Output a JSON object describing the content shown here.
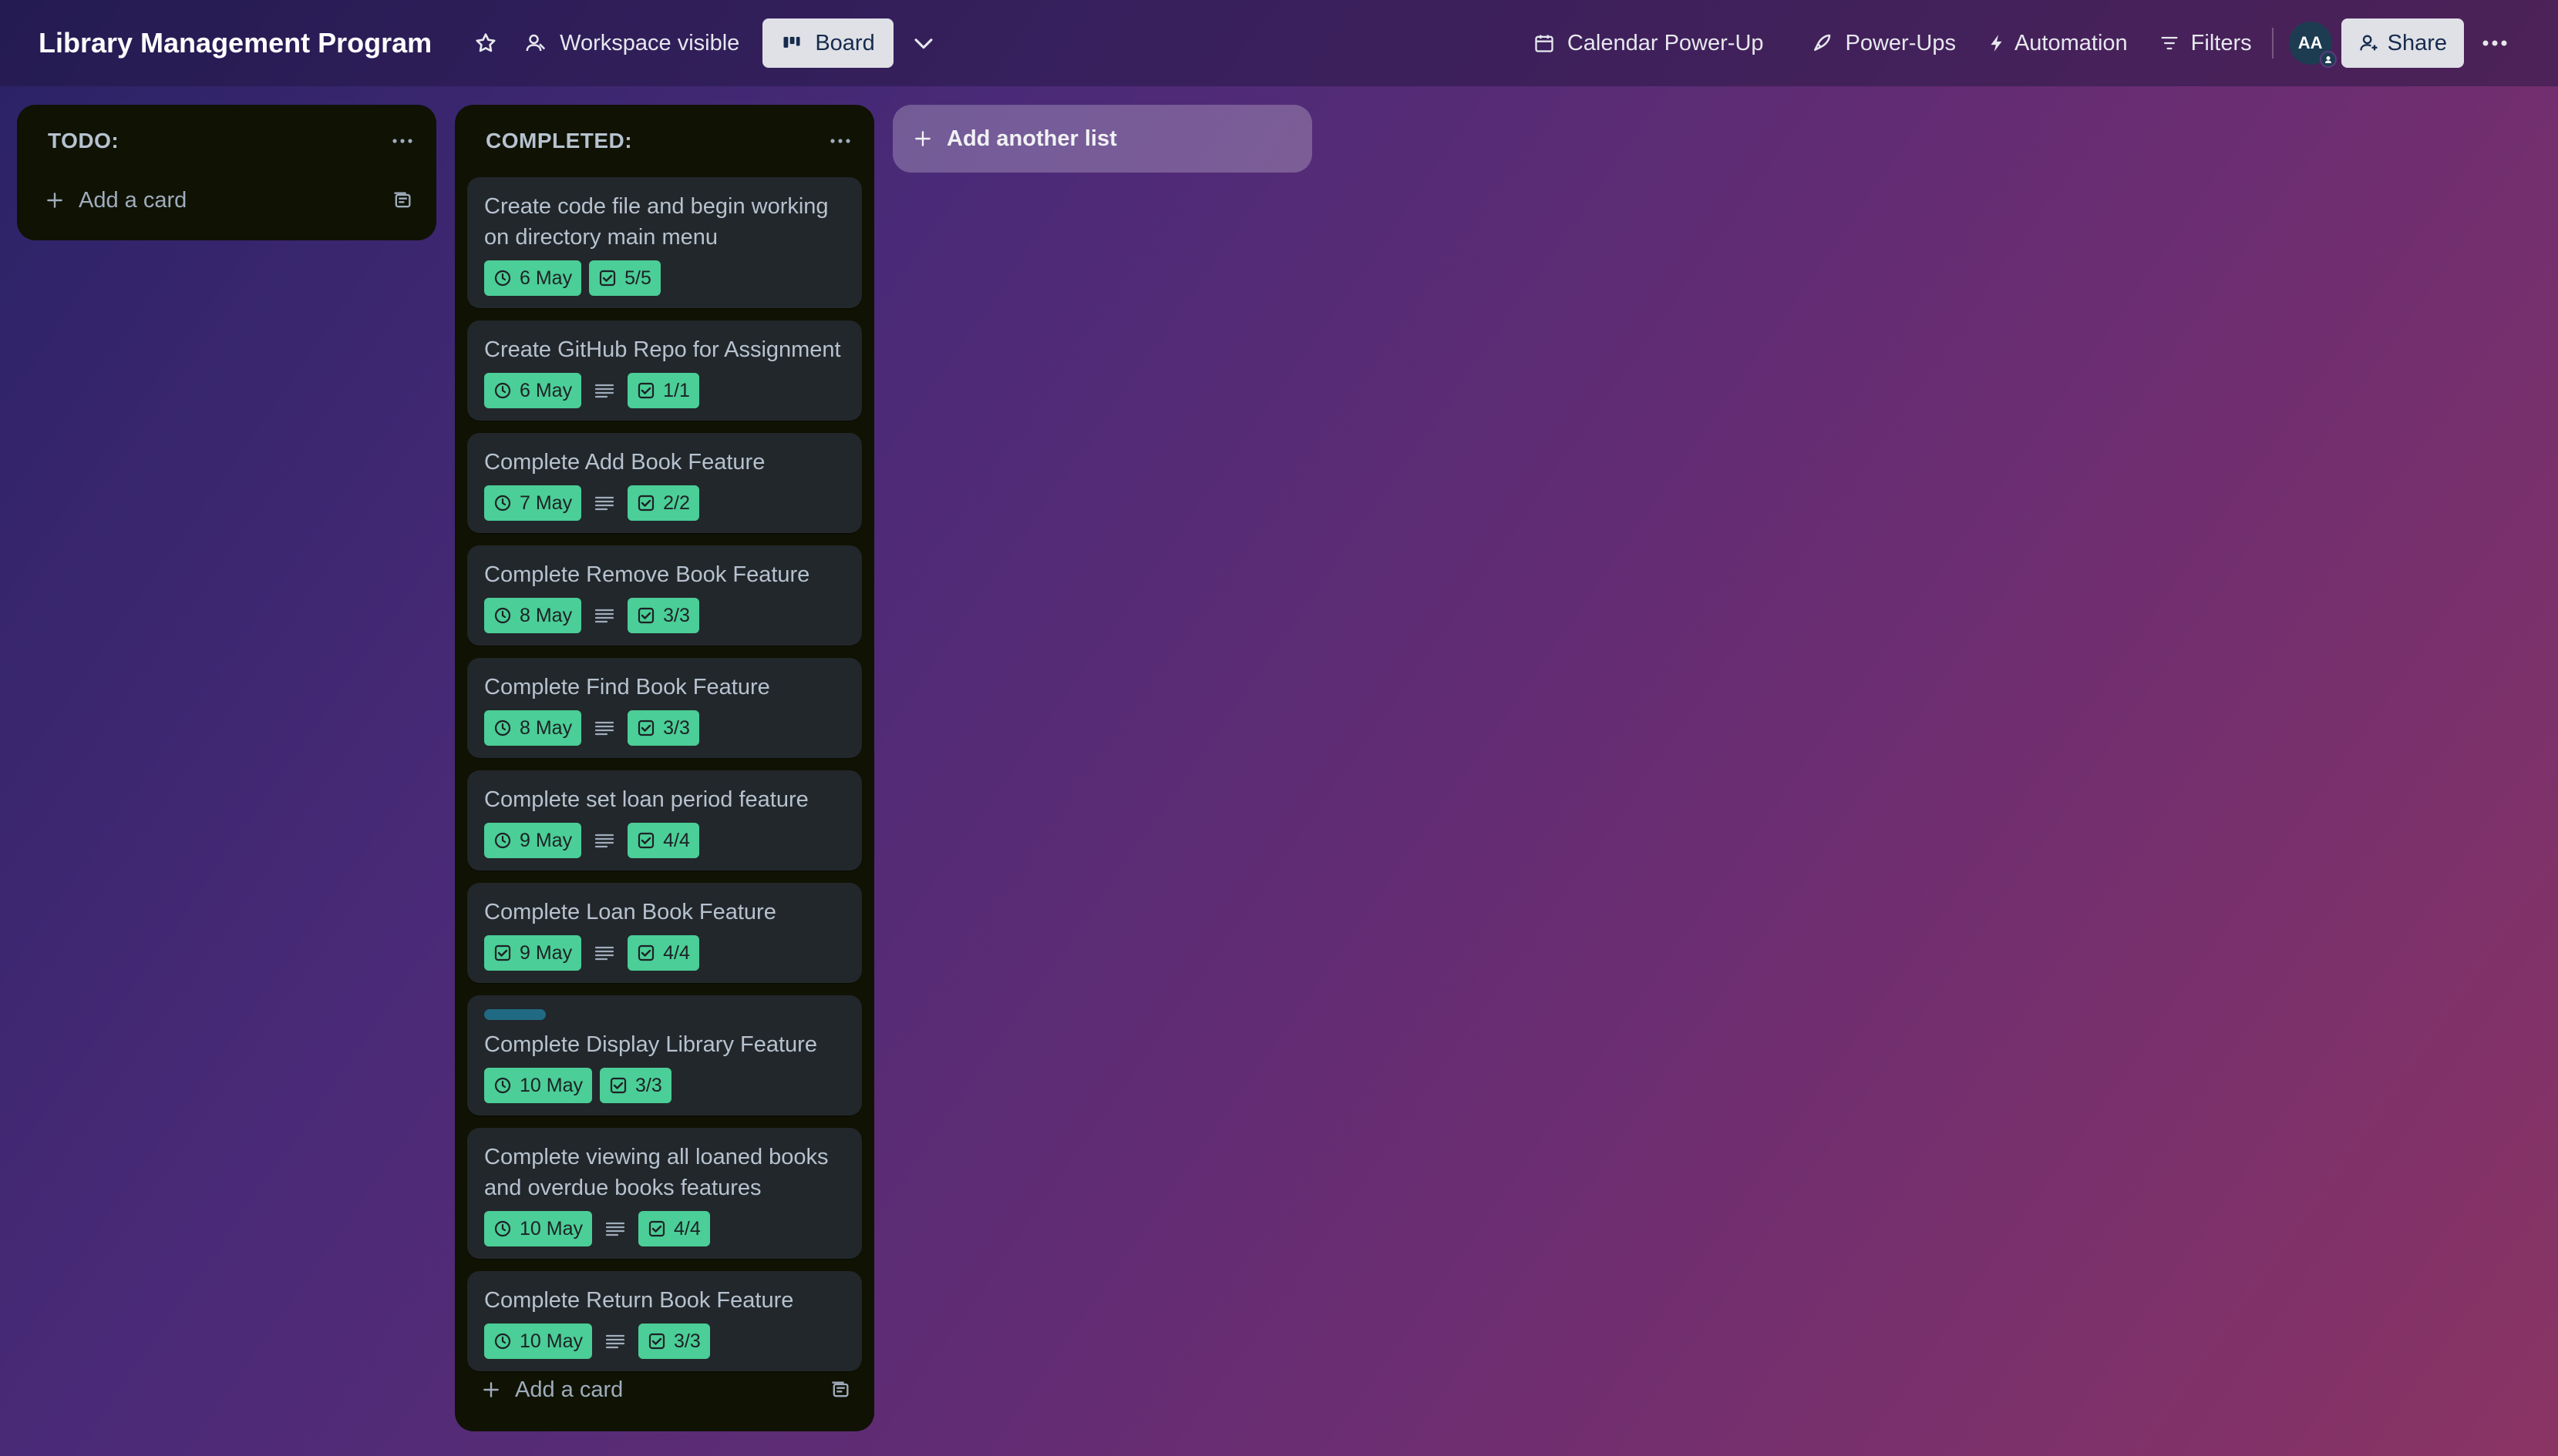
{
  "header": {
    "board_title": "Library Management Program",
    "visibility_label": "Workspace visible",
    "view_label": "Board",
    "calendar_label": "Calendar Power-Up",
    "powerups_label": "Power-Ups",
    "automation_label": "Automation",
    "filters_label": "Filters",
    "avatar_initials": "AA",
    "share_label": "Share"
  },
  "lists": {
    "todo": {
      "title": "TODO:",
      "add_card_label": "Add a card"
    },
    "completed": {
      "title": "COMPLETED:",
      "add_card_label": "Add a card",
      "cards": [
        {
          "title": "Create code file and begin working on directory main menu",
          "due": "6 May",
          "checklist": "5/5",
          "has_description": false,
          "has_label": false
        },
        {
          "title": "Create GitHub Repo for Assignment",
          "due": "6 May",
          "checklist": "1/1",
          "has_description": true,
          "has_label": false
        },
        {
          "title": "Complete Add Book Feature",
          "due": "7 May",
          "checklist": "2/2",
          "has_description": true,
          "has_label": false
        },
        {
          "title": "Complete Remove Book Feature",
          "due": "8 May",
          "checklist": "3/3",
          "has_description": true,
          "has_label": false
        },
        {
          "title": "Complete Find Book Feature",
          "due": "8 May",
          "checklist": "3/3",
          "has_description": true,
          "has_label": false
        },
        {
          "title": "Complete set loan period feature",
          "due": "9 May",
          "checklist": "4/4",
          "has_description": true,
          "has_label": false
        },
        {
          "title": "Complete Loan Book Feature",
          "due": "9 May",
          "checklist": "4/4",
          "has_description": true,
          "has_label": false,
          "due_icon": "checkbox"
        },
        {
          "title": "Complete Display Library Feature",
          "due": "10 May",
          "checklist": "3/3",
          "has_description": false,
          "has_label": true
        },
        {
          "title": "Complete viewing all loaned books and overdue books features",
          "due": "10 May",
          "checklist": "4/4",
          "has_description": true,
          "has_label": false
        },
        {
          "title": "Complete Return Book Feature",
          "due": "10 May",
          "checklist": "3/3",
          "has_description": true,
          "has_label": false
        }
      ]
    }
  },
  "add_list_label": "Add another list",
  "colors": {
    "badge_green": "#4bce97",
    "label_teal": "#206a83",
    "list_bg": "#101204",
    "card_bg": "#22272b"
  }
}
